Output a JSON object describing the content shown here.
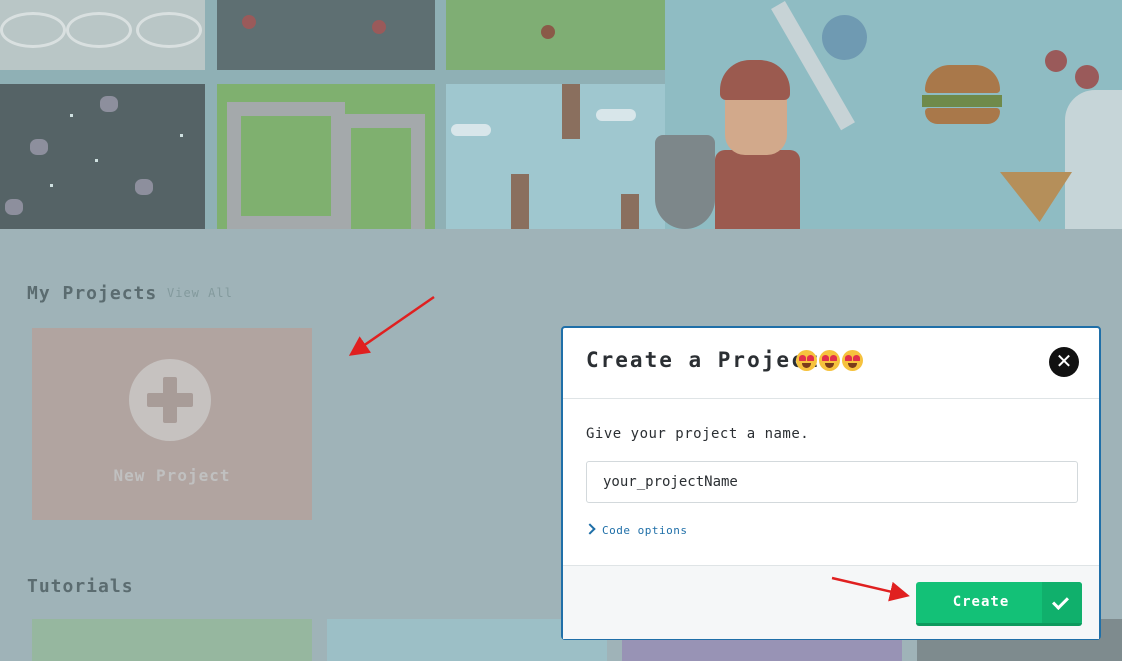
{
  "sections": {
    "my_projects": {
      "title": "My Projects",
      "view_all_label": "View All",
      "new_project_label": "New Project"
    },
    "tutorials": {
      "title": "Tutorials"
    }
  },
  "modal": {
    "title": "Create a Project",
    "title_emoji": "heart-eyes-emoji x3",
    "close_icon": "close-icon",
    "prompt": "Give your project a name.",
    "name_input_value": "your_projectName",
    "code_options_label": "Code options",
    "create_label": "Create",
    "create_icon": "check-icon"
  },
  "colors": {
    "modal_border": "#1f6fa8",
    "create_button": "#13c177",
    "annotation_arrow": "#e02020",
    "overlay_tint": "#9fb3b8"
  }
}
